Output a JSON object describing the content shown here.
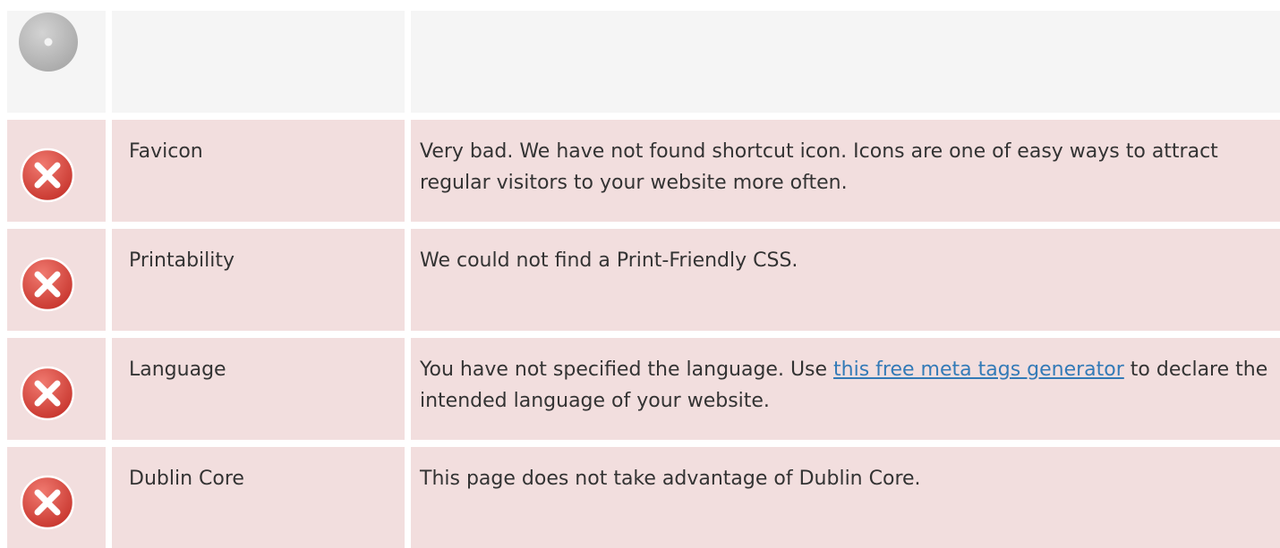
{
  "rows": [
    {
      "status": "neutral",
      "icon": "info-disc-icon",
      "label": "",
      "description": ""
    },
    {
      "status": "fail",
      "icon": "error-x-icon",
      "label": "Favicon",
      "description": "Very bad. We have not found shortcut icon. Icons are one of easy ways to attract regular visitors to your website more often."
    },
    {
      "status": "fail",
      "icon": "error-x-icon",
      "label": "Printability",
      "description": "We could not find a Print-Friendly CSS."
    },
    {
      "status": "fail",
      "icon": "error-x-icon",
      "label": "Language",
      "description_before": "You have not specified the language. Use ",
      "description_link": "this free meta tags generator",
      "description_after": " to declare the intended language of your website."
    },
    {
      "status": "fail",
      "icon": "error-x-icon",
      "label": "Dublin Core",
      "description": "This page does not take advantage of Dublin Core."
    }
  ],
  "colors": {
    "fail_row_bg": "#f2dede",
    "neutral_row_bg": "#f5f5f5",
    "error_icon": "#d9534f",
    "link": "#337ab7"
  }
}
